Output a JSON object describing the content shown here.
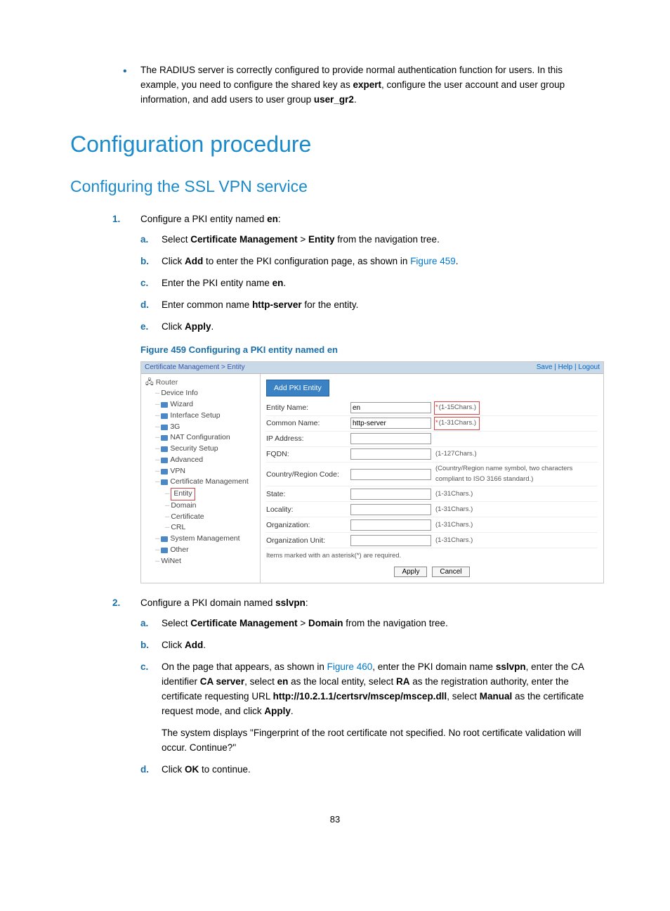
{
  "intro_bullet": {
    "part1": "The RADIUS server is correctly configured to provide normal authentication function for users. In this example, you need to configure the shared key as ",
    "b1": "expert",
    "part2": ", configure the user account and user group information, and add users to user group ",
    "b2": "user_gr2",
    "part3": "."
  },
  "heading1": "Configuration procedure",
  "heading2": "Configuring the SSL VPN service",
  "step1": {
    "marker": "1.",
    "lead_a": "Configure a PKI entity named ",
    "lead_b": "en",
    "lead_c": ":",
    "a": {
      "m": "a.",
      "t1": "Select ",
      "b1": "Certificate Management",
      "t2": " > ",
      "b2": "Entity",
      "t3": " from the navigation tree."
    },
    "b": {
      "m": "b.",
      "t1": "Click ",
      "b1": "Add",
      "t2": " to enter the PKI configuration page, as shown in ",
      "link": "Figure 459",
      "t3": "."
    },
    "c": {
      "m": "c.",
      "t1": "Enter the PKI entity name ",
      "b1": "en",
      "t2": "."
    },
    "d": {
      "m": "d.",
      "t1": "Enter common name ",
      "b1": "http-server",
      "t2": " for the entity."
    },
    "e": {
      "m": "e.",
      "t1": "Click ",
      "b1": "Apply",
      "t2": "."
    }
  },
  "figure_caption": "Figure 459 Configuring a PKI entity named en",
  "figure": {
    "breadcrumb": "Certificate Management > Entity",
    "links": {
      "save": "Save",
      "help": "Help",
      "logout": "Logout",
      "sep": " | "
    },
    "tree": [
      {
        "label": "Router",
        "level": 0,
        "folder": false,
        "root": true
      },
      {
        "label": "Device Info",
        "level": 1,
        "folder": false
      },
      {
        "label": "Wizard",
        "level": 1,
        "folder": true
      },
      {
        "label": "Interface Setup",
        "level": 1,
        "folder": true
      },
      {
        "label": "3G",
        "level": 1,
        "folder": true
      },
      {
        "label": "NAT Configuration",
        "level": 1,
        "folder": true
      },
      {
        "label": "Security Setup",
        "level": 1,
        "folder": true
      },
      {
        "label": "Advanced",
        "level": 1,
        "folder": true
      },
      {
        "label": "VPN",
        "level": 1,
        "folder": true
      },
      {
        "label": "Certificate Management",
        "level": 1,
        "folder": true
      },
      {
        "label": "Entity",
        "level": 2,
        "folder": false,
        "selected": true
      },
      {
        "label": "Domain",
        "level": 2,
        "folder": false
      },
      {
        "label": "Certificate",
        "level": 2,
        "folder": false
      },
      {
        "label": "CRL",
        "level": 2,
        "folder": false
      },
      {
        "label": "System Management",
        "level": 1,
        "folder": true
      },
      {
        "label": "Other",
        "level": 1,
        "folder": true
      },
      {
        "label": "WiNet",
        "level": 1,
        "folder": false
      }
    ],
    "add_btn": "Add PKI Entity",
    "rows": [
      {
        "label": "Entity Name:",
        "value": "en",
        "hint": "(1-15Chars.)",
        "required": true,
        "red": true
      },
      {
        "label": "Common Name:",
        "value": "http-server",
        "hint": "(1-31Chars.)",
        "required": true,
        "red": true
      },
      {
        "label": "IP Address:",
        "value": "",
        "hint": ""
      },
      {
        "label": "FQDN:",
        "value": "",
        "hint": "(1-127Chars.)"
      },
      {
        "label": "Country/Region Code:",
        "value": "",
        "hint": "(Country/Region name symbol, two characters compliant to ISO 3166 standard.)",
        "wrap": true
      },
      {
        "label": "State:",
        "value": "",
        "hint": "(1-31Chars.)"
      },
      {
        "label": "Locality:",
        "value": "",
        "hint": "(1-31Chars.)"
      },
      {
        "label": "Organization:",
        "value": "",
        "hint": "(1-31Chars.)"
      },
      {
        "label": "Organization Unit:",
        "value": "",
        "hint": "(1-31Chars.)"
      }
    ],
    "note": "Items marked with an asterisk(*) are required.",
    "apply": "Apply",
    "cancel": "Cancel"
  },
  "step2": {
    "marker": "2.",
    "lead_a": "Configure a PKI domain named ",
    "lead_b": "sslvpn",
    "lead_c": ":",
    "a": {
      "m": "a.",
      "t1": "Select ",
      "b1": "Certificate Management",
      "t2": " > ",
      "b2": "Domain",
      "t3": " from the navigation tree."
    },
    "b": {
      "m": "b.",
      "t1": "Click ",
      "b1": "Add",
      "t2": "."
    },
    "c": {
      "m": "c.",
      "t1": "On the page that appears, as shown in ",
      "link": "Figure 460",
      "t2": ", enter the PKI domain name ",
      "b1": "sslvpn",
      "t3": ", enter the CA identifier ",
      "b2": "CA server",
      "t4": ", select ",
      "b3": "en",
      "t5": " as the local entity, select ",
      "b4": "RA",
      "t6": " as the registration authority, enter the certificate requesting URL ",
      "b5": "http://10.2.1.1/certsrv/mscep/mscep.dll",
      "t7": ", select ",
      "b6": "Manual",
      "t8": " as the certificate request mode, and click ",
      "b7": "Apply",
      "t9": ".",
      "para": "The system displays \"Fingerprint of the root certificate not specified. No root certificate validation will occur. Continue?\""
    },
    "d": {
      "m": "d.",
      "t1": "Click ",
      "b1": "OK",
      "t2": " to continue."
    }
  },
  "page_number": "83"
}
